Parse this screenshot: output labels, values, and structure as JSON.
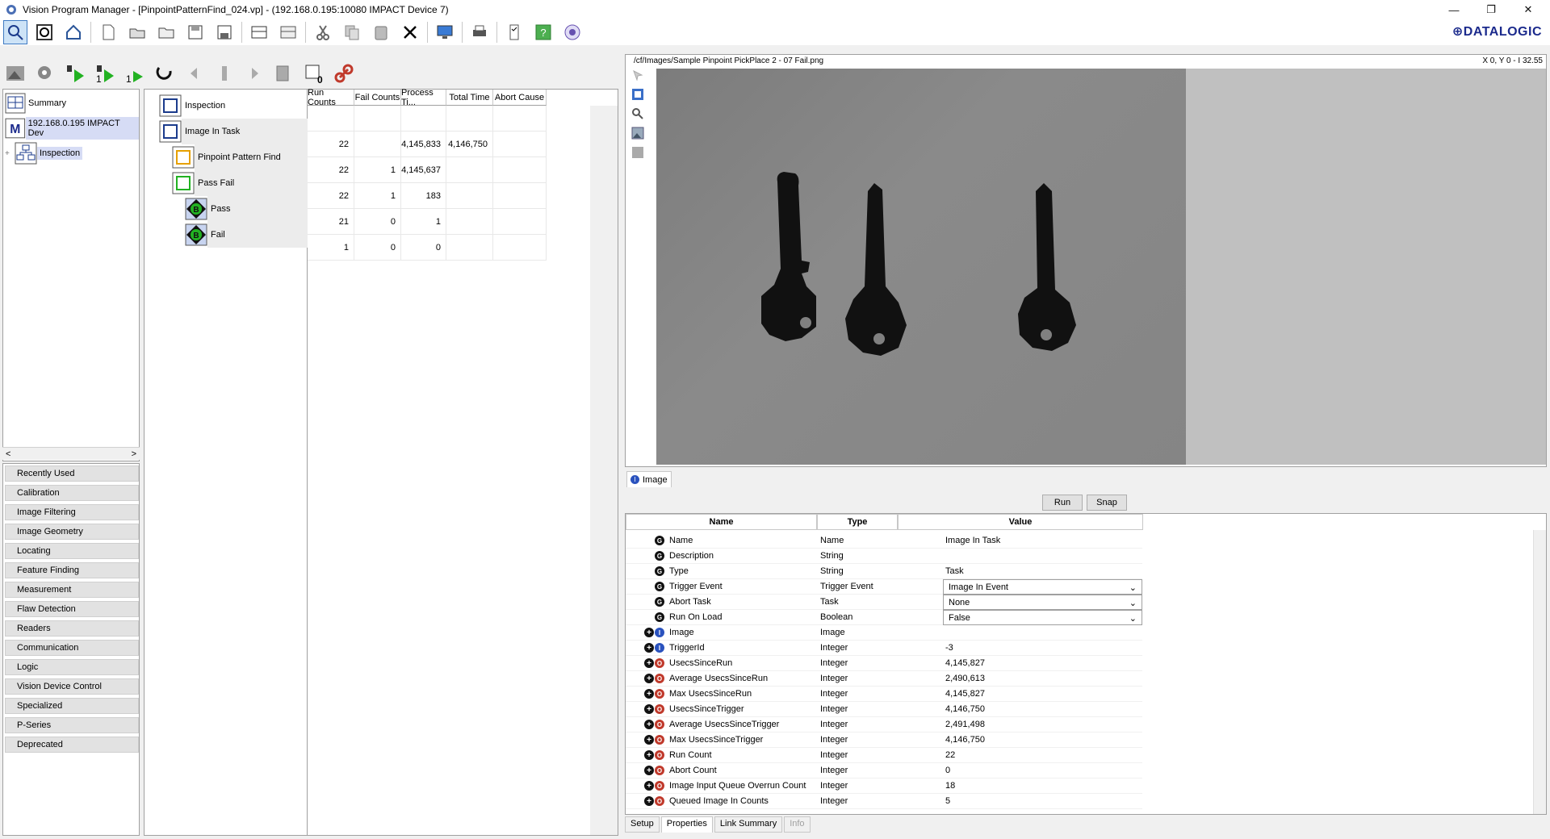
{
  "window": {
    "title": "Vision Program Manager - [PinpointPatternFind_024.vp] - (192.168.0.195:10080 IMPACT Device 7)",
    "minimize": "—",
    "restore": "❐",
    "close": "✕"
  },
  "brand": {
    "logo": "DATALOGIC",
    "accent": "#1b2a8c"
  },
  "left_tree": {
    "items": [
      {
        "label": "Summary",
        "icon": "summary-icon"
      },
      {
        "label": "192.168.0.195 IMPACT Dev",
        "icon": "device-m-icon"
      },
      {
        "label": "Inspection",
        "icon": "inspection-icon",
        "expander": "+"
      }
    ],
    "scroll_left": "<",
    "scroll_right": ">"
  },
  "categories": [
    "Recently Used",
    "Calibration",
    "Image Filtering",
    "Image Geometry",
    "Locating",
    "Feature Finding",
    "Measurement",
    "Flaw Detection",
    "Readers",
    "Communication",
    "Logic",
    "Vision Device Control",
    "Specialized",
    "P-Series",
    "Deprecated"
  ],
  "task_grid": {
    "columns": [
      "Run Counts",
      "Fail Counts",
      "Process Ti...",
      "Total Time",
      "Abort Cause"
    ],
    "rows": [
      {
        "name": "Inspection",
        "cells": [
          "",
          "",
          "",
          "",
          ""
        ]
      },
      {
        "name": "Image In Task",
        "cells": [
          "22",
          "",
          "4,145,833",
          "4,146,750",
          ""
        ]
      },
      {
        "name": "Pinpoint Pattern Find",
        "cells": [
          "22",
          "1",
          "4,145,637",
          "",
          ""
        ]
      },
      {
        "name": "Pass Fail",
        "cells": [
          "22",
          "1",
          "183",
          "",
          ""
        ]
      },
      {
        "name": "Pass",
        "cells": [
          "21",
          "0",
          "1",
          "",
          ""
        ]
      },
      {
        "name": "Fail",
        "cells": [
          "1",
          "0",
          "0",
          "",
          ""
        ]
      }
    ]
  },
  "viewer": {
    "path": "/cf/Images/Sample Pinpoint PickPlace 2 - 07 Fail.png",
    "coords": "X 0, Y 0 - I 32.55",
    "tab_label": "Image"
  },
  "actions": {
    "run": "Run",
    "snap": "Snap"
  },
  "properties": {
    "columns": [
      "Name",
      "Type",
      "Value"
    ],
    "rows": [
      {
        "icon": "G",
        "name": "Name",
        "type": "Name",
        "value": "Image In Task"
      },
      {
        "icon": "G",
        "name": "Description",
        "type": "String",
        "value": ""
      },
      {
        "icon": "G",
        "name": "Type",
        "type": "String",
        "value": "Task"
      },
      {
        "icon": "G",
        "name": "Trigger Event",
        "type": "Trigger Event",
        "value": "Image In Event",
        "dropdown": true
      },
      {
        "icon": "G",
        "name": "Abort Task",
        "type": "Task",
        "value": "None",
        "dropdown": true
      },
      {
        "icon": "G",
        "name": "Run On Load",
        "type": "Boolean",
        "value": "False",
        "dropdown": true
      },
      {
        "icon": "I",
        "name": "Image",
        "type": "Image",
        "value": "",
        "expand": true
      },
      {
        "icon": "I",
        "name": "TriggerId",
        "type": "Integer",
        "value": "-3",
        "expand": true
      },
      {
        "icon": "O",
        "name": "UsecsSinceRun",
        "type": "Integer",
        "value": "4,145,827",
        "expand": true
      },
      {
        "icon": "O",
        "name": "Average UsecsSinceRun",
        "type": "Integer",
        "value": "2,490,613",
        "expand": true
      },
      {
        "icon": "O",
        "name": "Max UsecsSinceRun",
        "type": "Integer",
        "value": "4,145,827",
        "expand": true
      },
      {
        "icon": "O",
        "name": "UsecsSinceTrigger",
        "type": "Integer",
        "value": "4,146,750",
        "expand": true
      },
      {
        "icon": "O",
        "name": "Average UsecsSinceTrigger",
        "type": "Integer",
        "value": "2,491,498",
        "expand": true
      },
      {
        "icon": "O",
        "name": "Max UsecsSinceTrigger",
        "type": "Integer",
        "value": "4,146,750",
        "expand": true
      },
      {
        "icon": "O",
        "name": "Run Count",
        "type": "Integer",
        "value": "22",
        "expand": true
      },
      {
        "icon": "O",
        "name": "Abort Count",
        "type": "Integer",
        "value": "0",
        "expand": true
      },
      {
        "icon": "O",
        "name": "Image Input Queue Overrun Count",
        "type": "Integer",
        "value": "18",
        "expand": true
      },
      {
        "icon": "O",
        "name": "Queued Image In Counts",
        "type": "Integer",
        "value": "5",
        "expand": true
      }
    ]
  },
  "bottom_tabs": [
    "Setup",
    "Properties",
    "Link Summary",
    "Info"
  ],
  "icon_colors": {
    "G": "#111111",
    "I": "#2a52be",
    "O": "#c0392b"
  }
}
